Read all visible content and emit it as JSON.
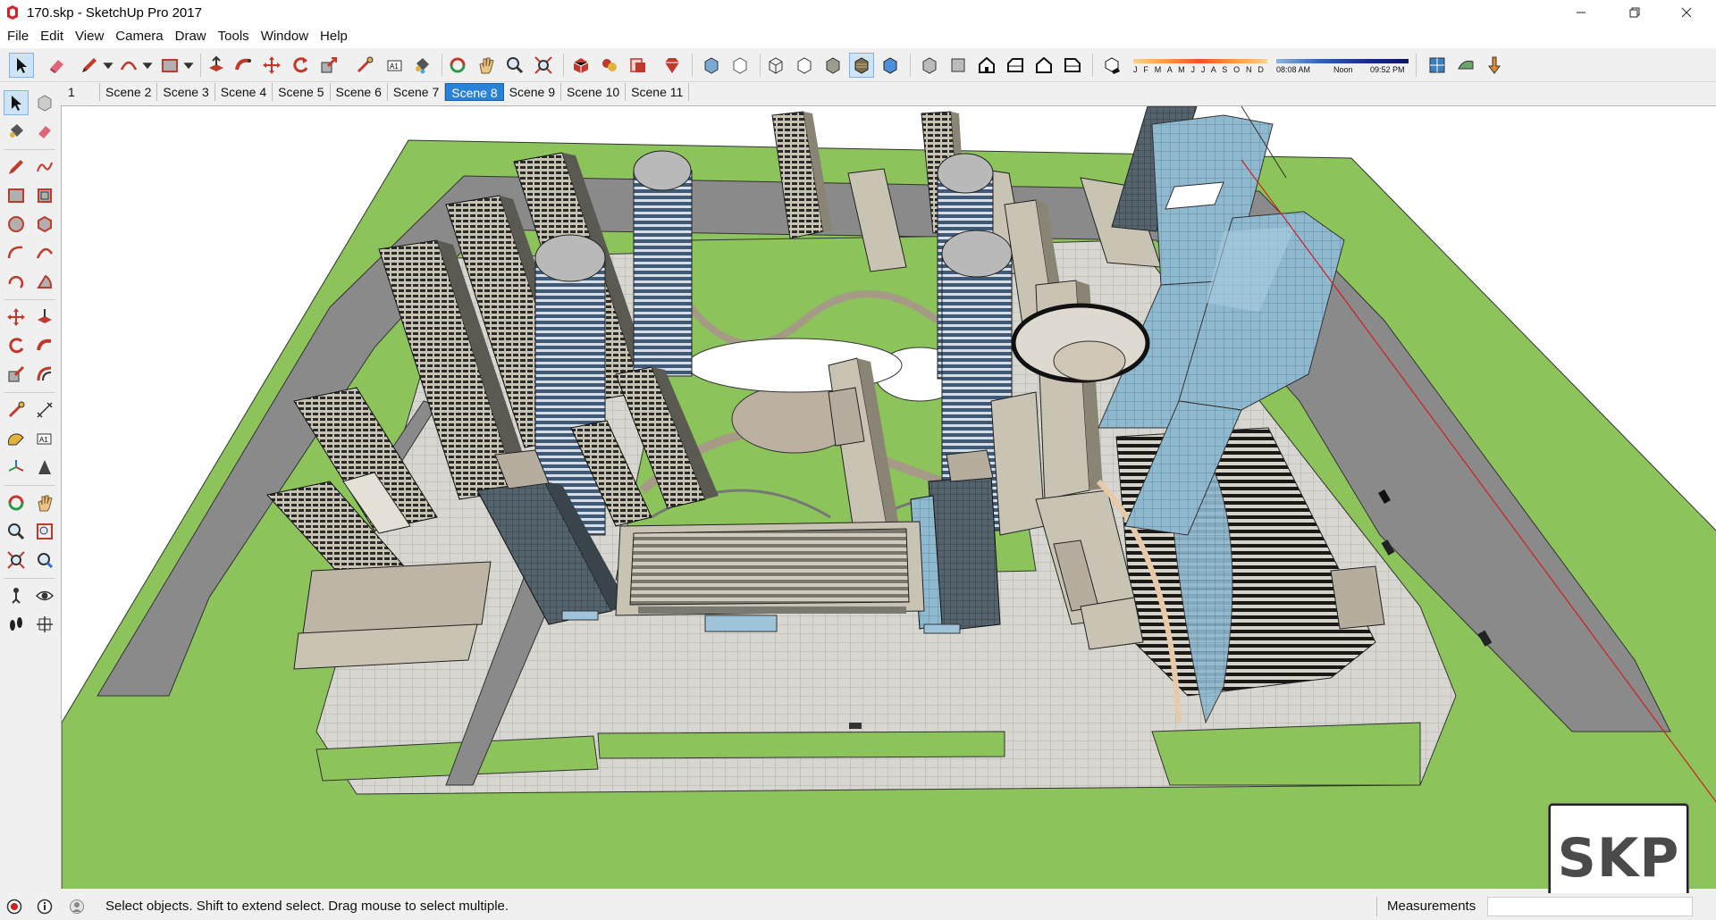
{
  "window": {
    "title": "170.skp - SketchUp Pro 2017",
    "controls": [
      "minimize",
      "restore",
      "close"
    ]
  },
  "menu": {
    "items": [
      "File",
      "Edit",
      "View",
      "Camera",
      "Draw",
      "Tools",
      "Window",
      "Help"
    ]
  },
  "toolbar": {
    "shadow_months": "J F M A M J J A S O N D",
    "shadow_time_start": "08:08 AM",
    "shadow_time_mid": "Noon",
    "shadow_time_end": "09:52 PM"
  },
  "scenes": {
    "tabs": [
      "1",
      "Scene 2",
      "Scene 3",
      "Scene 4",
      "Scene 5",
      "Scene 6",
      "Scene 7",
      "Scene 8",
      "Scene 9",
      "Scene 10",
      "Scene 11"
    ],
    "active": "Scene 8"
  },
  "watermark": {
    "text": "SKP"
  },
  "status": {
    "hint": "Select objects. Shift to extend select. Drag mouse to select multiple.",
    "measurements_label": "Measurements",
    "measurements_value": ""
  },
  "colors": {
    "accent": "#2a82d8",
    "grass": "#8cc35a",
    "road": "#8a8a8a",
    "building": "#c8c2b4",
    "glass": "#8fb9cf"
  }
}
